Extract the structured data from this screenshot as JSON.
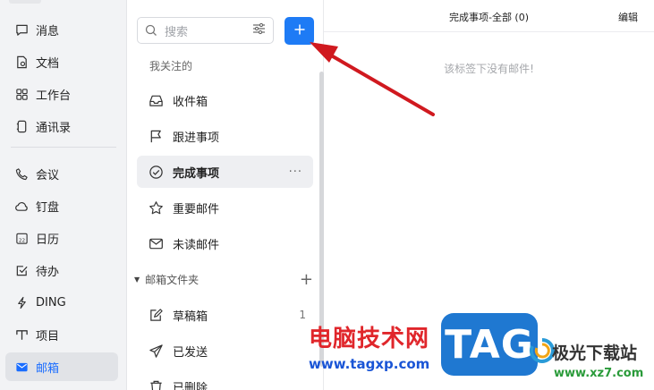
{
  "nav": {
    "items": [
      {
        "label": "消息",
        "icon": "message-icon"
      },
      {
        "label": "文档",
        "icon": "document-icon"
      },
      {
        "label": "工作台",
        "icon": "workbench-icon"
      },
      {
        "label": "通讯录",
        "icon": "contacts-icon"
      },
      {
        "label": "会议",
        "icon": "meeting-icon"
      },
      {
        "label": "钉盘",
        "icon": "cloud-drive-icon"
      },
      {
        "label": "日历",
        "icon": "calendar-icon"
      },
      {
        "label": "待办",
        "icon": "todo-icon"
      },
      {
        "label": "DING",
        "icon": "ding-icon"
      },
      {
        "label": "项目",
        "icon": "project-icon"
      },
      {
        "label": "邮箱",
        "icon": "mail-icon"
      }
    ],
    "active": "邮箱"
  },
  "folders": {
    "search_placeholder": "搜索",
    "followed_label": "我关注的",
    "followed": [
      {
        "label": "收件箱",
        "icon": "inbox-icon"
      },
      {
        "label": "跟进事项",
        "icon": "flag-icon"
      },
      {
        "label": "完成事项",
        "icon": "check-circle-icon",
        "more": "···"
      },
      {
        "label": "重要邮件",
        "icon": "star-icon"
      },
      {
        "label": "未读邮件",
        "icon": "envelope-icon"
      }
    ],
    "mailbox_folder_label": "邮箱文件夹",
    "mailbox": [
      {
        "label": "草稿箱",
        "icon": "draft-icon",
        "count": "1"
      },
      {
        "label": "已发送",
        "icon": "send-icon"
      },
      {
        "label": "已删除",
        "icon": "trash-icon"
      }
    ]
  },
  "content": {
    "title": "完成事项-全部 (0)",
    "edit_label": "编辑",
    "empty_text": "该标签下没有邮件!"
  },
  "watermark": {
    "cn_text": "电脑技术网",
    "url": "www.tagxp.com",
    "tag": "TAG",
    "site_cn": "极光下载站",
    "site_url": "www.xz7.com"
  },
  "colors": {
    "accent": "#1e7bf5",
    "annotation_arrow": "#d0191f"
  }
}
